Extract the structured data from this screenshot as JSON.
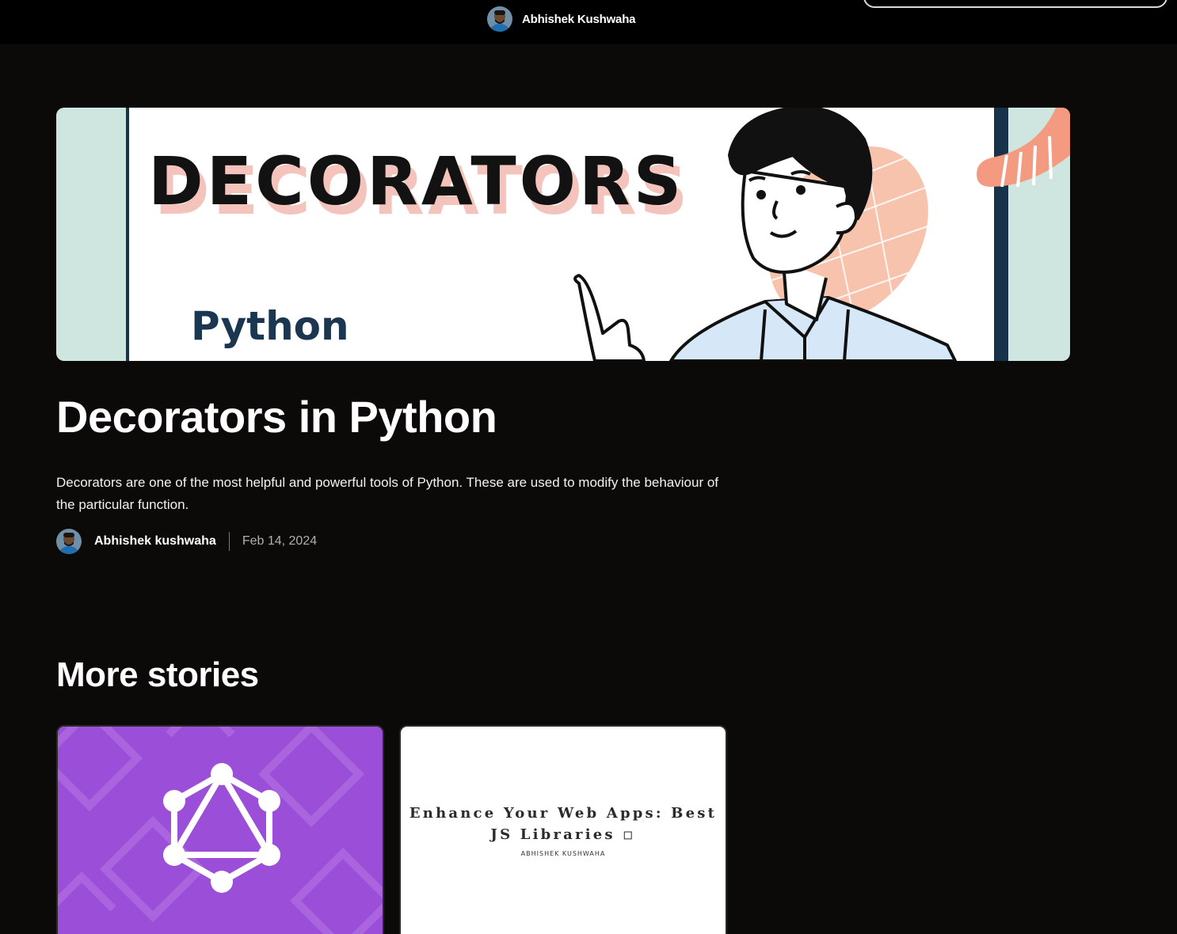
{
  "header": {
    "site_name": "Abhishek Kushwaha"
  },
  "post": {
    "cover": {
      "headline": "DECORATORS",
      "subtitle": "Python"
    },
    "title": "Decorators in Python",
    "description": "Decorators are one of the most helpful and powerful tools of Python. These are used to modify the behaviour of the particular function.",
    "author": "Abhishek kushwaha",
    "date": "Feb 14, 2024"
  },
  "more_stories": {
    "heading": "More stories",
    "cards": [
      {
        "icon": "graphql-icon",
        "background": "#9b4fd8"
      },
      {
        "cover_title": "Enhance Your Web Apps: Best JS Libraries ◽",
        "cover_author": "ABHISHEK KUSHWAHA"
      }
    ]
  },
  "colors": {
    "background": "#0c0a08",
    "topbar": "#000000",
    "hero_mint": "#cfe5e0",
    "hero_navy": "#16334a",
    "hero_peach": "#f6b49a",
    "graphql_purple": "#9b4fd8"
  }
}
